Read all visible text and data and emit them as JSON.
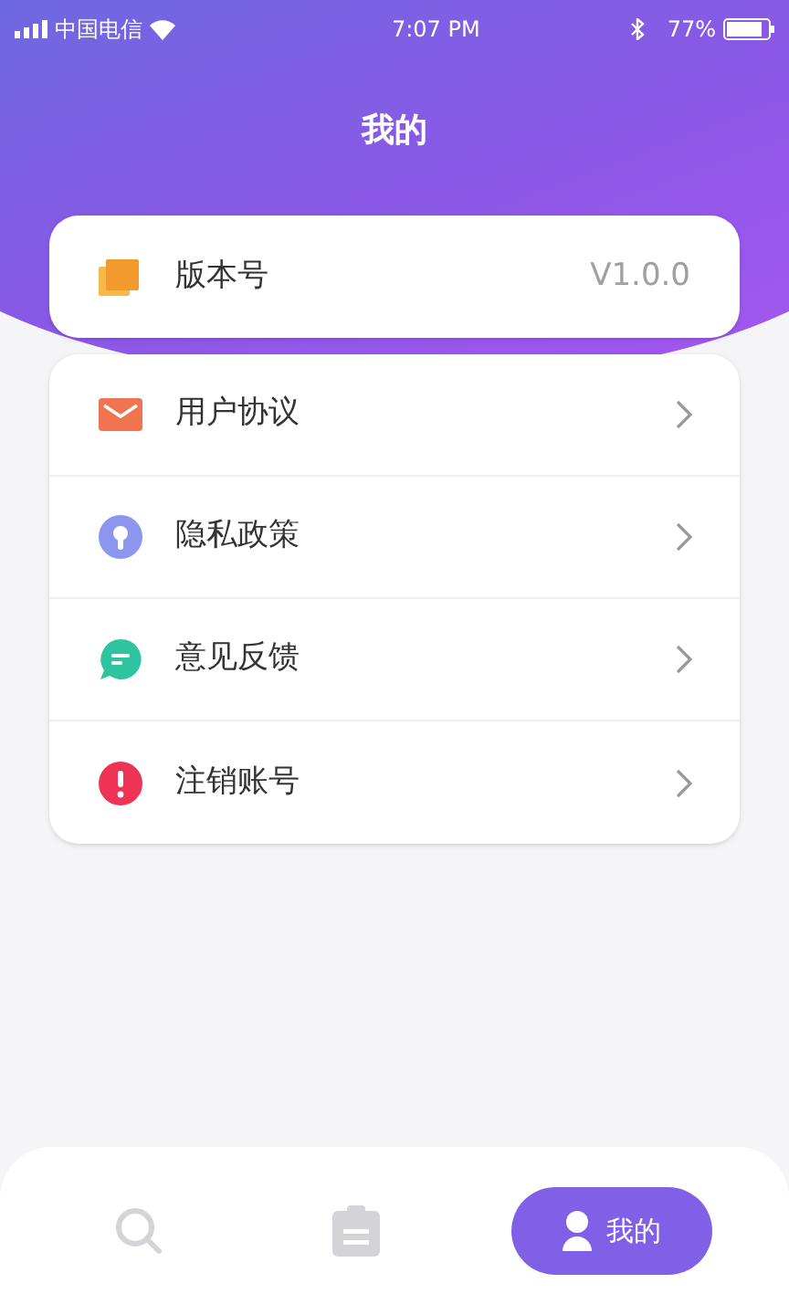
{
  "status_bar": {
    "carrier": "中国电信",
    "time": "7:07 PM",
    "battery": "77%"
  },
  "title": "我的",
  "version": {
    "label": "版本号",
    "value": "V1.0.0"
  },
  "menu": [
    {
      "label": "用户协议",
      "kind": "mail"
    },
    {
      "label": "隐私政策",
      "kind": "lock"
    },
    {
      "label": "意见反馈",
      "kind": "chat"
    },
    {
      "label": "注销账号",
      "kind": "alert"
    }
  ],
  "tabs": [
    {
      "kind": "search",
      "selected": false
    },
    {
      "kind": "clipboard",
      "selected": false
    },
    {
      "kind": "person",
      "label": "我的",
      "selected": true
    }
  ]
}
